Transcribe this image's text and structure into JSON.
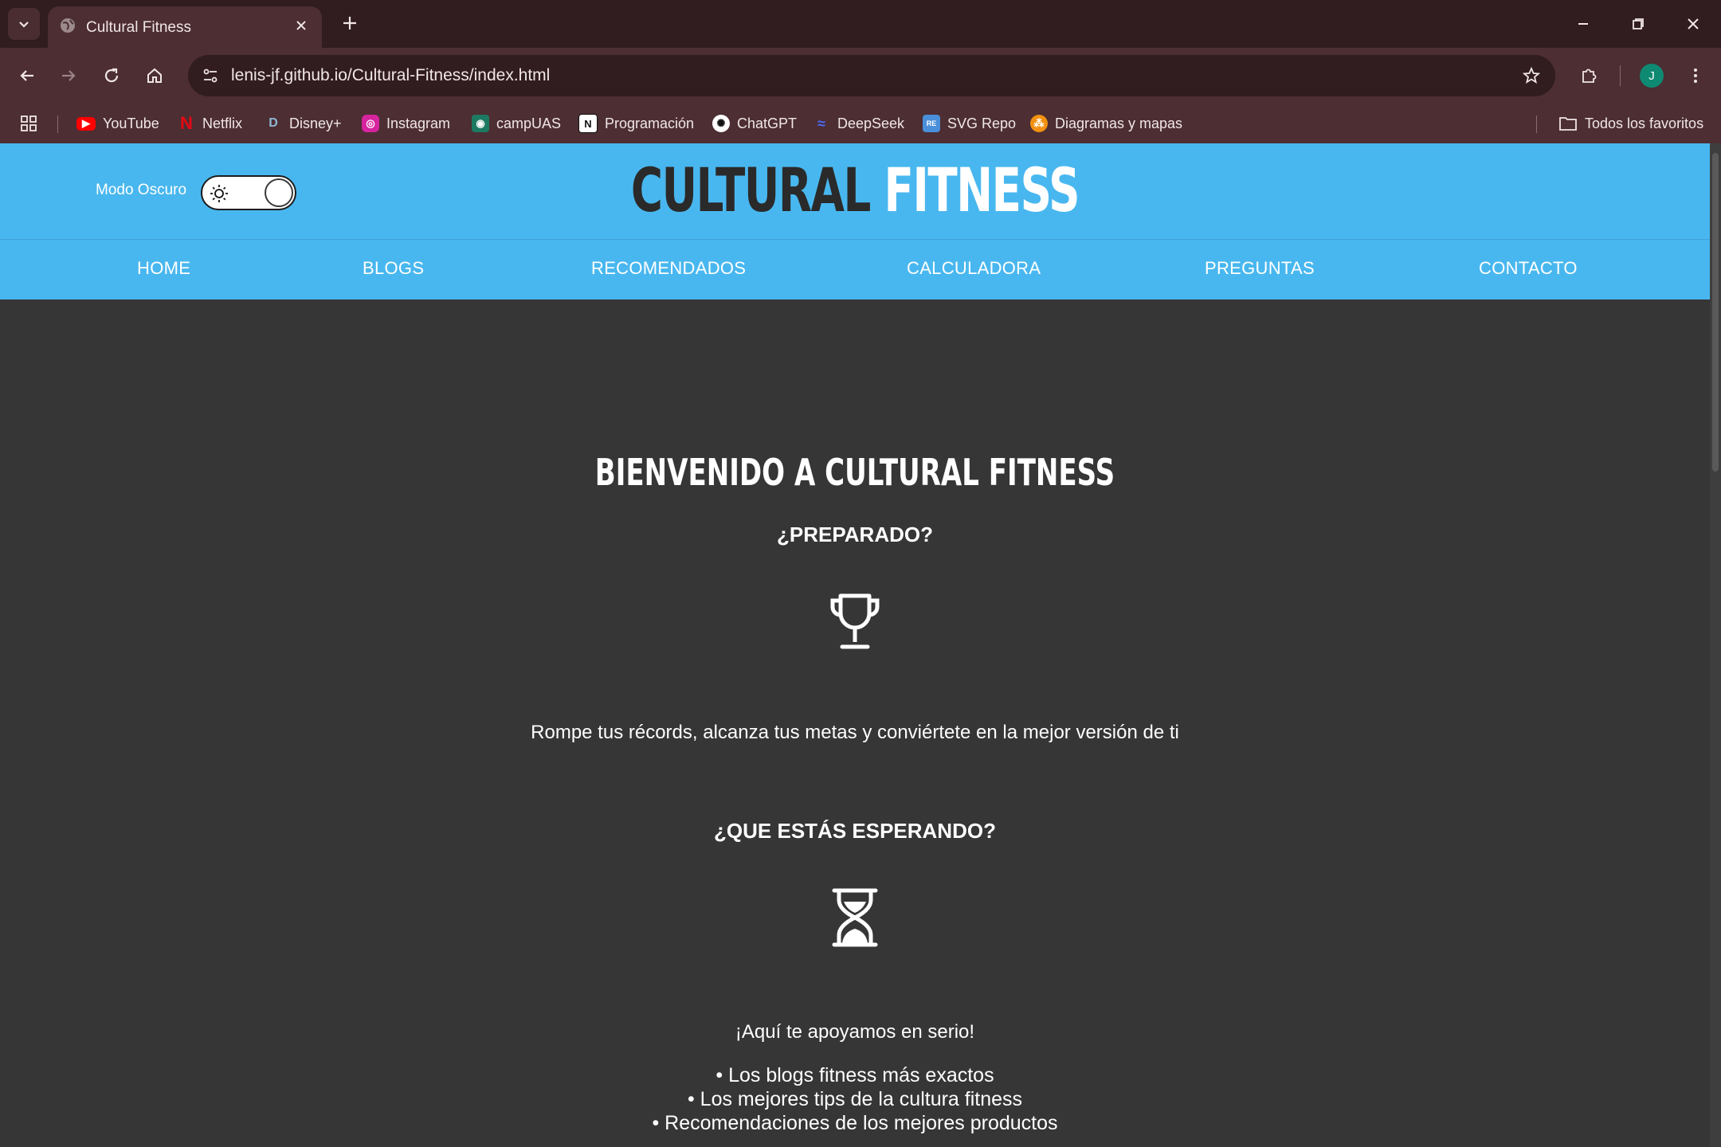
{
  "browser": {
    "tab_title": "Cultural Fitness",
    "url": "lenis-jf.github.io/Cultural-Fitness/index.html",
    "avatar_letter": "J",
    "bookmarks": [
      {
        "label": "YouTube",
        "icon": "youtube-icon"
      },
      {
        "label": "Netflix",
        "icon": "netflix-icon"
      },
      {
        "label": "Disney+",
        "icon": "disney-icon"
      },
      {
        "label": "Instagram",
        "icon": "instagram-icon"
      },
      {
        "label": "campUAS",
        "icon": "campuas-icon"
      },
      {
        "label": "Programación",
        "icon": "notion-icon"
      },
      {
        "label": "ChatGPT",
        "icon": "chatgpt-icon"
      },
      {
        "label": "DeepSeek",
        "icon": "deepseek-icon"
      },
      {
        "label": "SVG Repo",
        "icon": "svgrepo-icon"
      },
      {
        "label": "Diagramas y mapas",
        "icon": "diagrams-icon"
      }
    ],
    "all_bookmarks_label": "Todos los favoritos"
  },
  "header": {
    "dark_mode_label": "Modo Oscuro",
    "brand_word1": "CULTURAL",
    "brand_word2": "FITNESS",
    "nav": [
      "HOME",
      "BLOGS",
      "RECOMENDADOS",
      "CALCULADORA",
      "PREGUNTAS",
      "CONTACTO"
    ]
  },
  "main": {
    "title": "BIENVENIDO A CULTURAL FITNESS",
    "subtitle1": "¿PREPARADO?",
    "paragraph1": "Rompe tus récords, alcanza tus metas y conviértete en la mejor versión de ti",
    "subtitle2": "¿QUE ESTÁS ESPERANDO?",
    "paragraph2": "¡Aquí te apoyamos en serio!",
    "bullets": [
      "• Los blogs fitness más exactos",
      "• Los mejores tips de la cultura fitness",
      "• Recomendaciones de los mejores productos"
    ]
  },
  "colors": {
    "header_bg": "#49b7ef",
    "page_bg": "#363636",
    "chrome_bg": "#4c2e33",
    "tabstrip_bg": "#311c1f"
  }
}
